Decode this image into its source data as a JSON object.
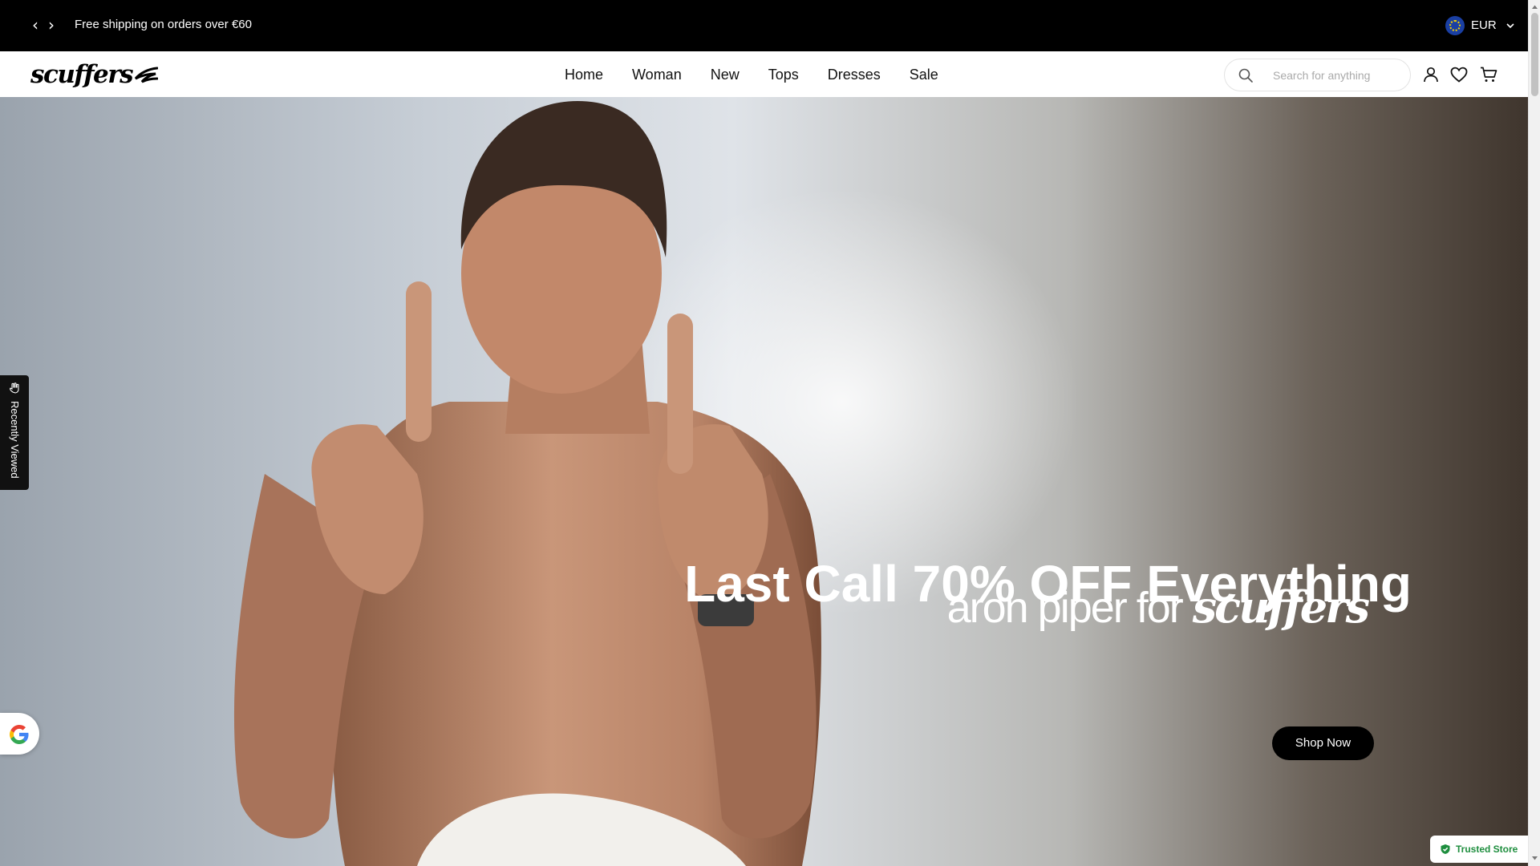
{
  "announcement": {
    "prev_icon": "‹",
    "next_icon": "›",
    "message": "Free shipping on orders over €60",
    "currency": "EUR"
  },
  "header": {
    "logo_text": "scuffers",
    "nav": [
      "Home",
      "Woman",
      "New",
      "Tops",
      "Dresses",
      "Sale"
    ],
    "search_placeholder": "Search for anything",
    "icons": [
      "search-icon",
      "account-icon",
      "wishlist-heart-icon",
      "cart-icon"
    ]
  },
  "hero": {
    "title": "Last Call 70% OFF Everything",
    "subtitle_prefix": "aron piper for ",
    "subtitle_brand": "scuffers",
    "cta": "Shop Now"
  },
  "widgets": {
    "recently_viewed": "Recently Viewed",
    "trusted_store": "Trusted Store"
  },
  "colors": {
    "topbar": "#000000",
    "button": "#000000",
    "trusted": "#1e8e3e"
  }
}
